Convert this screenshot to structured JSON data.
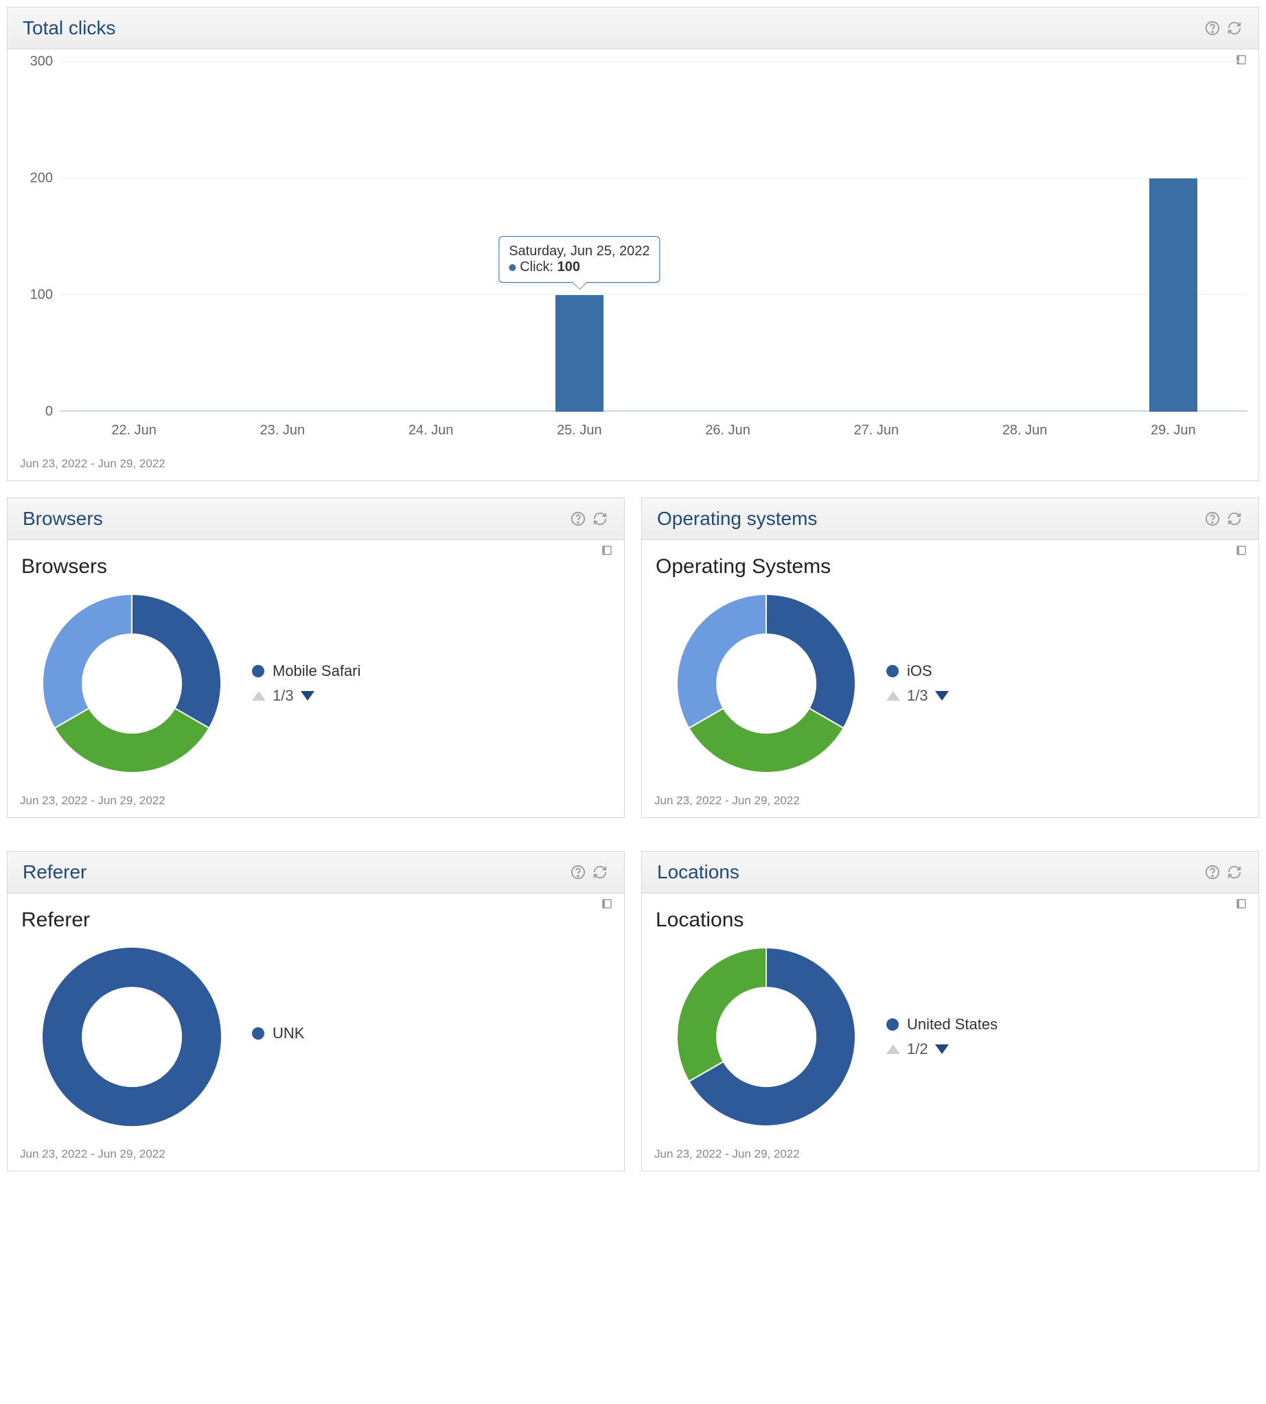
{
  "date_range": "Jun 23, 2022 - Jun 29, 2022",
  "chart_data": [
    {
      "id": "total_clicks",
      "type": "bar",
      "title": "Total clicks",
      "categories": [
        "22. Jun",
        "23. Jun",
        "24. Jun",
        "25. Jun",
        "26. Jun",
        "27. Jun",
        "28. Jun",
        "29. Jun"
      ],
      "values": [
        0,
        0,
        0,
        100,
        0,
        0,
        0,
        200
      ],
      "ylabel": "",
      "xlabel": "",
      "ylim": [
        0,
        300
      ],
      "y_ticks": [
        0,
        100,
        200,
        300
      ],
      "series_name": "Click",
      "tooltip": {
        "category_index": 3,
        "date_label": "Saturday, Jun 25, 2022",
        "series": "Click",
        "value": 100
      }
    },
    {
      "id": "browsers",
      "type": "pie",
      "panel_title": "Browsers",
      "chart_title": "Browsers",
      "slices": [
        {
          "label": "Mobile Safari",
          "fraction": 0.3333,
          "color": "#2f5a99"
        },
        {
          "label": "(slice 2)",
          "fraction": 0.3333,
          "color": "#52a736"
        },
        {
          "label": "(slice 3)",
          "fraction": 0.3333,
          "color": "#6d9be0"
        }
      ],
      "legend_visible": "Mobile Safari",
      "legend_color": "#2f5a99",
      "pager": "1/3"
    },
    {
      "id": "os",
      "type": "pie",
      "panel_title": "Operating systems",
      "chart_title": "Operating Systems",
      "slices": [
        {
          "label": "iOS",
          "fraction": 0.3333,
          "color": "#2f5a99"
        },
        {
          "label": "(slice 2)",
          "fraction": 0.3333,
          "color": "#52a736"
        },
        {
          "label": "(slice 3)",
          "fraction": 0.3333,
          "color": "#6d9be0"
        }
      ],
      "legend_visible": "iOS",
      "legend_color": "#2f5a99",
      "pager": "1/3"
    },
    {
      "id": "referer",
      "type": "pie",
      "panel_title": "Referer",
      "chart_title": "Referer",
      "slices": [
        {
          "label": "UNK",
          "fraction": 1.0,
          "color": "#2f5a99"
        }
      ],
      "legend_visible": "UNK",
      "legend_color": "#2f5a99",
      "pager": null
    },
    {
      "id": "locations",
      "type": "pie",
      "panel_title": "Locations",
      "chart_title": "Locations",
      "slices": [
        {
          "label": "United States",
          "fraction": 0.6667,
          "color": "#2f5a99"
        },
        {
          "label": "(slice 2)",
          "fraction": 0.3333,
          "color": "#52a736"
        }
      ],
      "legend_visible": "United States",
      "legend_color": "#2f5a99",
      "pager": "1/2"
    }
  ]
}
